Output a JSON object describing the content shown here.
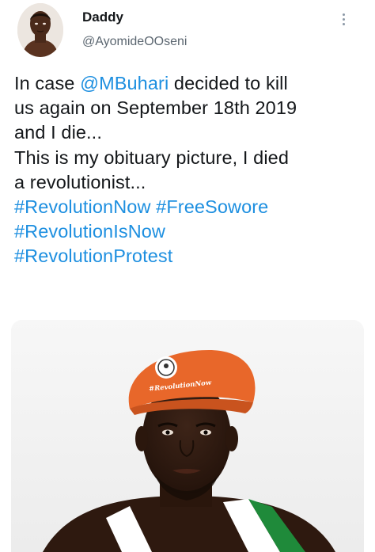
{
  "tweet": {
    "author": {
      "display_name": "Daddy",
      "handle": "@AyomideOOseni"
    },
    "text": {
      "l1_pre": "In case ",
      "mention": "@MBuhari",
      "l1_post": " decided to kill",
      "l2": "us again on September 18th 2019",
      "l3": "and I die...",
      "l4": "This is my obituary picture, I died",
      "l5": "a revolutionist...",
      "hashtag1": "#RevolutionNow",
      "hashtag2": "#FreeSowore",
      "hashtag3": "#RevolutionIsNow",
      "hashtag4": "#RevolutionProtest"
    },
    "media": {
      "beret_text": "#RevolutionNow"
    },
    "colors": {
      "link": "#1d8fe0",
      "beret": "#e8672a",
      "handle": "#5b6670"
    },
    "icons": {
      "more": "more-vertical-icon"
    }
  }
}
